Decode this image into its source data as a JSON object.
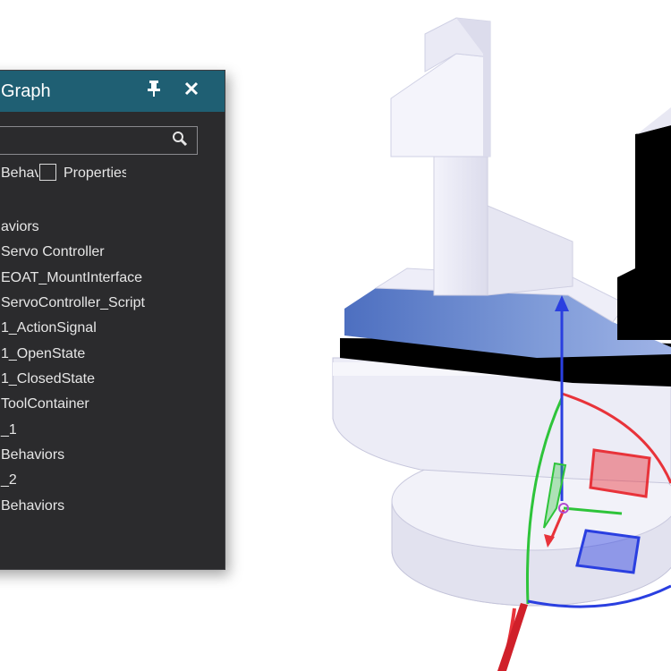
{
  "panel": {
    "title": "Graph",
    "pin_icon": "pin-icon",
    "close_icon": "close-icon",
    "search": {
      "value": "",
      "icon": "search-icon"
    },
    "filters": [
      {
        "label": "Behavior",
        "checked": false
      },
      {
        "label": "Properties",
        "checked": false
      }
    ],
    "tree": [
      "aviors",
      "Servo Controller",
      "EOAT_MountInterface",
      "ServoController_Script",
      "1_ActionSignal",
      "1_OpenState",
      "1_ClosedState",
      "ToolContainer",
      "_1",
      "Behaviors",
      "_2",
      "Behaviors"
    ]
  },
  "colors": {
    "panel_bg": "#2b2b2d",
    "titlebar": "#1f5f73",
    "model_body": "#e4e4f2",
    "model_shadow": "#000000",
    "ramp_blue": "#5f7fc8",
    "axis_x": "#e8333a",
    "axis_y": "#2ec43a",
    "axis_z": "#2a3fe0"
  }
}
